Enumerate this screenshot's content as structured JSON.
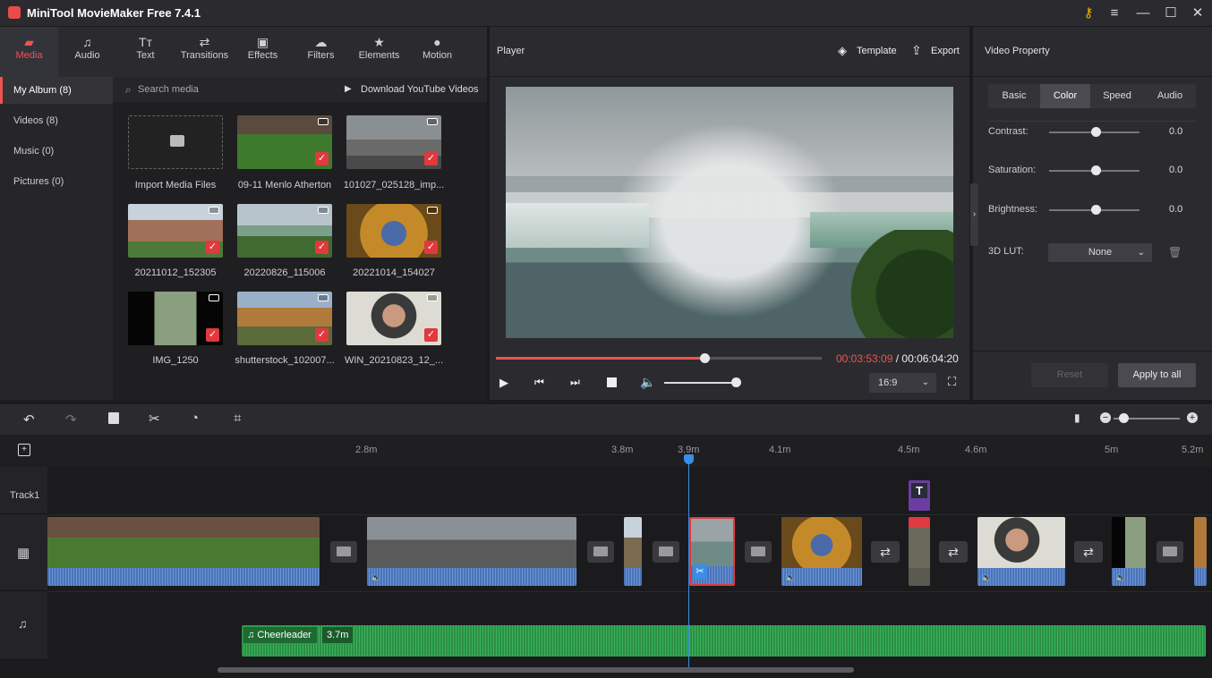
{
  "app": {
    "title": "MiniTool MovieMaker Free 7.4.1"
  },
  "nav": {
    "tabs": [
      {
        "label": "Media",
        "icon": "folder-icon"
      },
      {
        "label": "Audio",
        "icon": "music-note-icon"
      },
      {
        "label": "Text",
        "icon": "text-icon"
      },
      {
        "label": "Transitions",
        "icon": "swap-icon"
      },
      {
        "label": "Effects",
        "icon": "effects-icon"
      },
      {
        "label": "Filters",
        "icon": "filters-icon"
      },
      {
        "label": "Elements",
        "icon": "elements-icon"
      },
      {
        "label": "Motion",
        "icon": "motion-icon"
      }
    ],
    "active": "Media"
  },
  "sidebar": {
    "items": [
      {
        "label": "My Album (8)"
      },
      {
        "label": "Videos (8)"
      },
      {
        "label": "Music (0)"
      },
      {
        "label": "Pictures (0)"
      }
    ]
  },
  "library": {
    "search_placeholder": "Search media",
    "download_label": "Download YouTube Videos",
    "import_label": "Import Media Files",
    "items": [
      {
        "name": "09-11 Menlo Atherton"
      },
      {
        "name": "101027_025128_imp..."
      },
      {
        "name": "20211012_152305"
      },
      {
        "name": "20220826_115006"
      },
      {
        "name": "20221014_154027"
      },
      {
        "name": "IMG_1250"
      },
      {
        "name": "shutterstock_102007..."
      },
      {
        "name": "WIN_20210823_12_..."
      }
    ]
  },
  "player": {
    "title": "Player",
    "template_label": "Template",
    "export_label": "Export",
    "current_time": "00:03:53:09",
    "separator": " / ",
    "total_time": "00:06:04:20",
    "progress": 0.64,
    "volume": 1.0,
    "aspect": "16:9"
  },
  "property": {
    "title": "Video Property",
    "tabs": [
      "Basic",
      "Color",
      "Speed",
      "Audio"
    ],
    "active_tab": "Color",
    "contrast": {
      "label": "Contrast:",
      "value": "0.0"
    },
    "saturation": {
      "label": "Saturation:",
      "value": "0.0"
    },
    "brightness": {
      "label": "Brightness:",
      "value": "0.0"
    },
    "lut": {
      "label": "3D LUT:",
      "value": "None"
    },
    "reset_label": "Reset",
    "apply_label": "Apply to all"
  },
  "timeline": {
    "ticks": [
      "2.8m",
      "3.8m",
      "3.9m",
      "4.1m",
      "4.5m",
      "4.6m",
      "5m",
      "5.2m"
    ],
    "track1_label": "Track1",
    "audio_clip": {
      "name": "Cheerleader",
      "duration": "3.7m"
    },
    "text_clip_label": "T"
  },
  "colors": {
    "accent": "#ef5350",
    "playhead": "#3a8ee6",
    "audio": "#2fa04e"
  }
}
